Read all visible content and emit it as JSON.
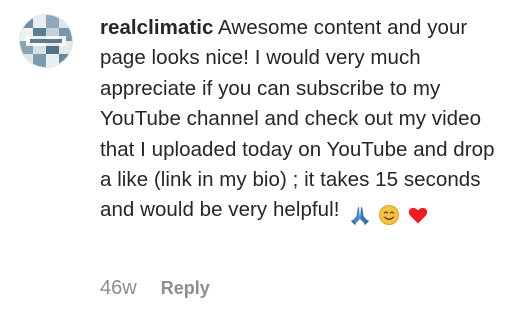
{
  "comment": {
    "username": "realclimatic",
    "text": "Awesome content and your page looks nice! I would very much appreciate if you can subscribe to my YouTube channel and check out my video that I uploaded today on YouTube and drop a like (link in my bio) ; it takes 15 seconds and would be very helpful!",
    "emojis": [
      "folded-hands-icon",
      "smiling-face-icon",
      "red-heart-icon"
    ],
    "timestamp": "46w",
    "reply_label": "Reply"
  },
  "colors": {
    "text": "#262626",
    "meta": "#8e8e8e",
    "heart": "#ed1c24",
    "smile": "#f5c342",
    "hands": "#4a86c8"
  }
}
